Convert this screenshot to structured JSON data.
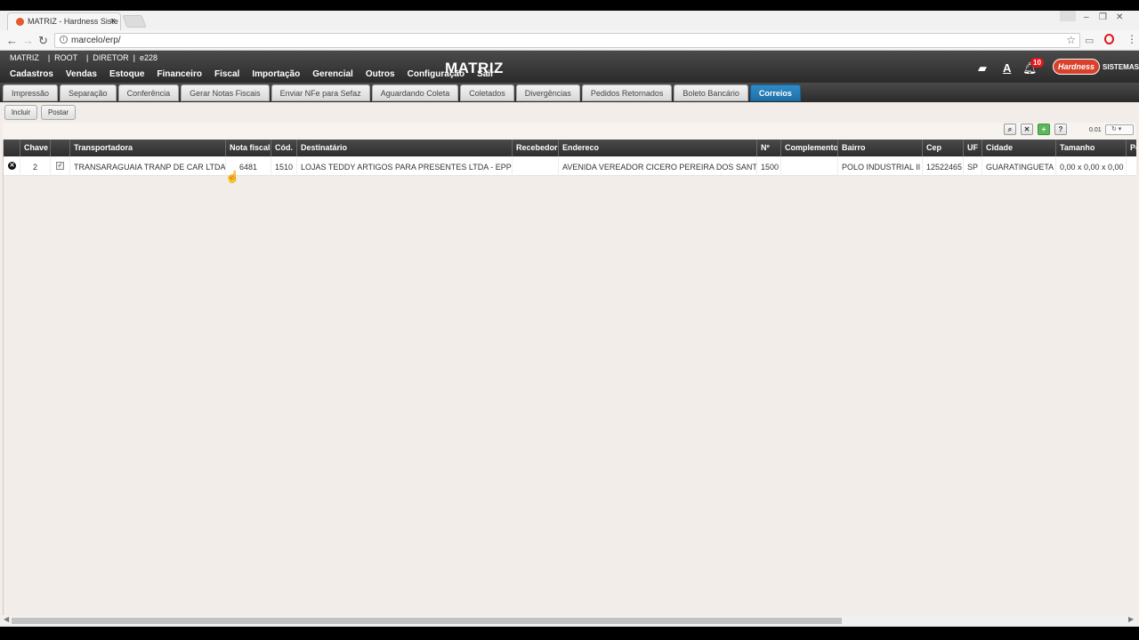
{
  "browser": {
    "tab_title": "MATRIZ - Hardness Siste",
    "tab_close": "×",
    "url": "marcelo/erp/",
    "back": "←",
    "forward": "→",
    "reload": "↻",
    "star": "☆",
    "menu": "⋮"
  },
  "header": {
    "userline": "MATRIZ    |  ROOT    |  DIRETOR  |  e228",
    "title": "MATRIZ",
    "menu": [
      "Cadastros",
      "Vendas",
      "Estoque",
      "Financeiro",
      "Fiscal",
      "Importação",
      "Gerencial",
      "Outros",
      "Configuração",
      "Sair"
    ],
    "notifications": "10",
    "logo_text": "Hardness",
    "logo_sub": "SISTEMAS"
  },
  "tabs": [
    {
      "label": "Impressão",
      "active": false
    },
    {
      "label": "Separação",
      "active": false
    },
    {
      "label": "Conferência",
      "active": false
    },
    {
      "label": "Gerar Notas Fiscais",
      "active": false
    },
    {
      "label": "Enviar NFe para Sefaz",
      "active": false
    },
    {
      "label": "Aguardando Coleta",
      "active": false
    },
    {
      "label": "Coletados",
      "active": false
    },
    {
      "label": "Divergências",
      "active": false
    },
    {
      "label": "Pedidos Retornados",
      "active": false
    },
    {
      "label": "Boleto Bancário",
      "active": false
    },
    {
      "label": "Correios",
      "active": true
    }
  ],
  "toolbar": {
    "incluir": "Incluir",
    "postar": "Postar",
    "pager_value": "0.01"
  },
  "grid": {
    "columns": [
      "",
      "Chave",
      "",
      "Transportadora",
      "Nota fiscal",
      "Cód.",
      "Destinatário",
      "Recebedor",
      "Endereco",
      "Nº",
      "Complemento",
      "Bairro",
      "Cep",
      "UF",
      "Cidade",
      "Tamanho",
      "Pe"
    ],
    "rows": [
      {
        "chave": "2",
        "transportadora": "TRANSARAGUAIA TRANP DE CAR LTDA",
        "nota_fiscal": "6481",
        "cod": "1510",
        "destinatario": "LOJAS TEDDY ARTIGOS PARA PRESENTES LTDA - EPP",
        "recebedor": "",
        "endereco": "AVENIDA VEREADOR CICERO PEREIRA DOS SANT",
        "numero": "1500",
        "complemento": "",
        "bairro": "POLO INDUSTRIAL II",
        "cep": "12522465",
        "uf": "SP",
        "cidade": "GUARATINGUETA",
        "tamanho": "0,00 x 0,00 x 0,00"
      }
    ]
  },
  "colors": {
    "header_dark": "#2b2b2b",
    "active_tab": "#1f6fa8",
    "content_bg": "#f2ede8",
    "badge": "#e0161b"
  }
}
